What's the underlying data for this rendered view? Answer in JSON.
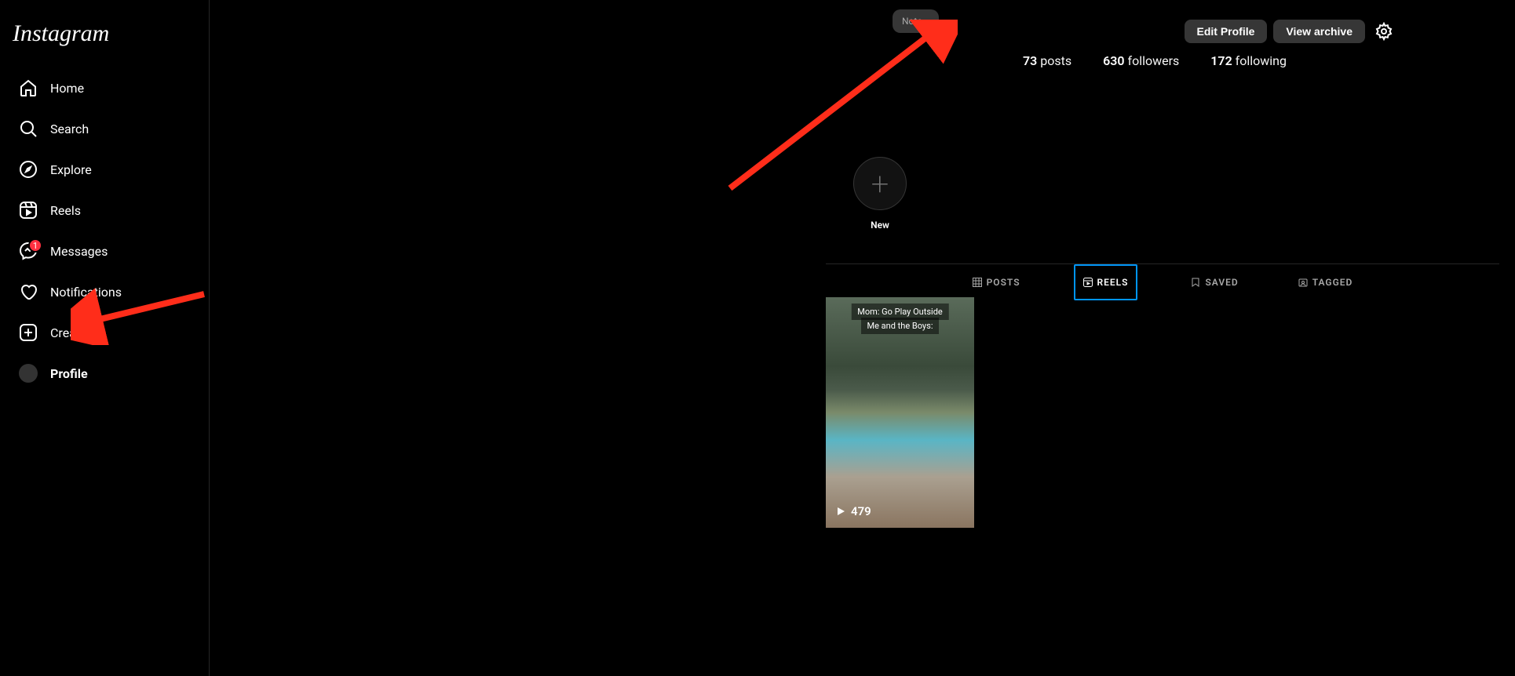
{
  "logo": "Instagram",
  "sidebar": {
    "items": [
      {
        "label": "Home",
        "icon": "home"
      },
      {
        "label": "Search",
        "icon": "search"
      },
      {
        "label": "Explore",
        "icon": "explore"
      },
      {
        "label": "Reels",
        "icon": "reels"
      },
      {
        "label": "Messages",
        "icon": "messages",
        "badge": "1"
      },
      {
        "label": "Notifications",
        "icon": "heart"
      },
      {
        "label": "Create",
        "icon": "create"
      },
      {
        "label": "Profile",
        "icon": "profile",
        "active": true
      }
    ]
  },
  "note": "Note...",
  "actions": {
    "edit_profile": "Edit Profile",
    "view_archive": "View archive"
  },
  "stats": {
    "posts_count": "73",
    "posts_label": "posts",
    "followers_count": "630",
    "followers_label": "followers",
    "following_count": "172",
    "following_label": "following"
  },
  "highlight": {
    "new_label": "New"
  },
  "tabs": {
    "posts": "POSTS",
    "reels": "REELS",
    "saved": "SAVED",
    "tagged": "TAGGED"
  },
  "reel": {
    "caption1": "Mom: Go Play Outside",
    "caption2": "Me and the Boys:",
    "views": "479"
  }
}
